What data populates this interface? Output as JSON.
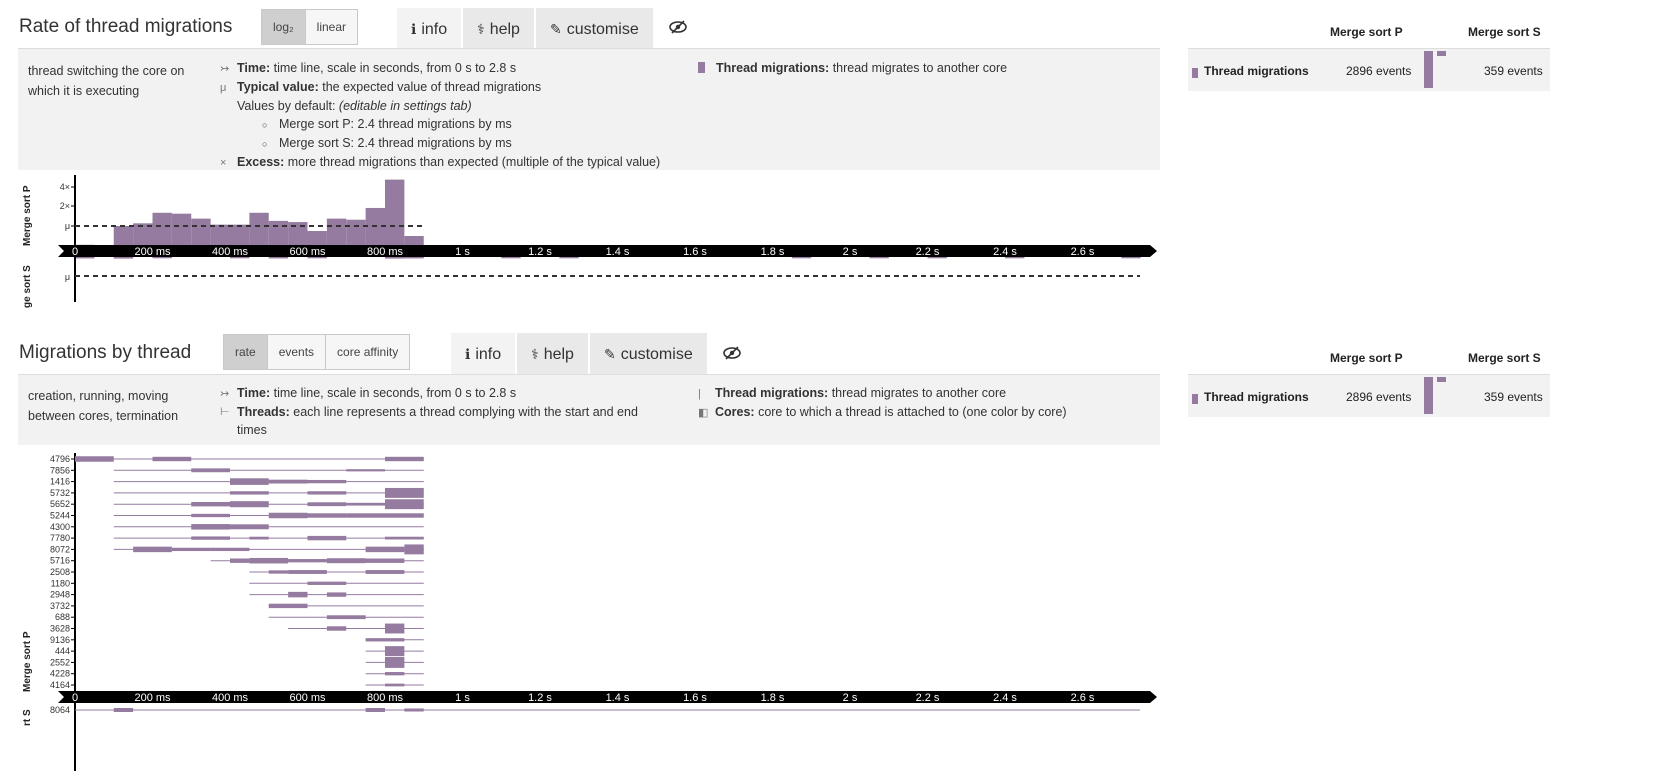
{
  "colors": {
    "accent": "#957ba0",
    "timeline": "#000000",
    "panel": "#f2f2f2"
  },
  "section1": {
    "title": "Rate of thread migrations",
    "scale_buttons": [
      {
        "label": "log₂",
        "active": true
      },
      {
        "label": "linear",
        "active": false
      }
    ],
    "tabs": [
      {
        "icon": "info-icon",
        "glyph": "ℹ",
        "label": "info"
      },
      {
        "icon": "stethoscope-icon",
        "glyph": "⚕",
        "label": "help"
      },
      {
        "icon": "brush-icon",
        "glyph": "🖌",
        "label": "customise"
      }
    ],
    "hide_icon": "eye-slash-icon",
    "description": "thread switching the core on which it is executing",
    "legend": {
      "time_bold": "Time:",
      "time_text": " time line, scale in seconds, from 0 s to 2.8 s",
      "typical_bold": "Typical value:",
      "typical_text": " the expected value of thread migrations",
      "defaults_text": "Values by default: ",
      "defaults_italic": "(editable in settings tab)",
      "default_items": [
        "Merge sort P: 2.4 thread migrations by ms",
        "Merge sort S: 2.4 thread migrations by ms"
      ],
      "excess_bold": "Excess:",
      "excess_text": " more thread migrations than expected (multiple of the typical value)",
      "metric_bold": "Thread migrations:",
      "metric_text": " thread migrates to another core"
    },
    "side": {
      "col1": "Merge sort P",
      "col2": "Merge sort S",
      "row_label": "Thread migrations",
      "val1": "2896 events",
      "val2": "359 events"
    },
    "chart": {
      "row1_label": "Merge sort P",
      "row2_label": "ge sort S",
      "yticks": [
        "4×",
        "2×",
        "μ"
      ],
      "row2_ytick": "μ",
      "axis_ticks": [
        "0",
        "200 ms",
        "400 ms",
        "600 ms",
        "800 ms",
        "1 s",
        "1.2 s",
        "1.4 s",
        "1.6 s",
        "1.8 s",
        "2 s",
        "2.2 s",
        "2.4 s",
        "2.6 s"
      ],
      "bar_width_ms": 50,
      "bars_p": [
        {
          "t": 0,
          "v": 0.25
        },
        {
          "t": 50,
          "v": 0.08
        },
        {
          "t": 100,
          "v": 1.0
        },
        {
          "t": 150,
          "v": 1.1
        },
        {
          "t": 200,
          "v": 1.6
        },
        {
          "t": 250,
          "v": 1.55
        },
        {
          "t": 300,
          "v": 1.3
        },
        {
          "t": 350,
          "v": 1.05
        },
        {
          "t": 400,
          "v": 1.05
        },
        {
          "t": 450,
          "v": 1.6
        },
        {
          "t": 500,
          "v": 1.2
        },
        {
          "t": 550,
          "v": 1.15
        },
        {
          "t": 600,
          "v": 0.8
        },
        {
          "t": 650,
          "v": 1.3
        },
        {
          "t": 700,
          "v": 1.25
        },
        {
          "t": 750,
          "v": 1.9
        },
        {
          "t": 800,
          "v": 5.2
        },
        {
          "t": 850,
          "v": 0.6
        }
      ],
      "bars_s": [
        {
          "t": 0,
          "v": 0.15
        },
        {
          "t": 100,
          "v": 0.2
        },
        {
          "t": 200,
          "v": 0.1
        },
        {
          "t": 400,
          "v": 0.1
        },
        {
          "t": 500,
          "v": 0.15
        },
        {
          "t": 600,
          "v": 0.1
        },
        {
          "t": 800,
          "v": 0.2
        },
        {
          "t": 850,
          "v": 0.15
        },
        {
          "t": 1100,
          "v": 0.1
        },
        {
          "t": 1250,
          "v": 0.1
        },
        {
          "t": 1850,
          "v": 0.1
        },
        {
          "t": 2050,
          "v": 0.1
        },
        {
          "t": 2200,
          "v": 0.1
        },
        {
          "t": 2400,
          "v": 0.1
        },
        {
          "t": 2700,
          "v": 0.1
        }
      ]
    }
  },
  "section2": {
    "title": "Migrations by thread",
    "mode_buttons": [
      {
        "label": "rate",
        "active": true
      },
      {
        "label": "events",
        "active": false
      },
      {
        "label": "core affinity",
        "active": false
      }
    ],
    "tabs": [
      {
        "icon": "info-icon",
        "glyph": "ℹ",
        "label": "info"
      },
      {
        "icon": "stethoscope-icon",
        "glyph": "⚕",
        "label": "help"
      },
      {
        "icon": "brush-icon",
        "glyph": "🖌",
        "label": "customise"
      }
    ],
    "hide_icon": "eye-slash-icon",
    "description": "creation, running, moving between cores, termination",
    "legend": {
      "time_bold": "Time:",
      "time_text": " time line, scale in seconds, from 0 s to 2.8 s",
      "threads_bold": "Threads:",
      "threads_text": " each line represents a thread complying with the start and end times",
      "metric_bold": "Thread migrations:",
      "metric_text": " thread migrates to another core",
      "cores_bold": "Cores:",
      "cores_text": " core to which a thread is attached to (one color by core)"
    },
    "side": {
      "col1": "Merge sort P",
      "col2": "Merge sort S",
      "row_label": "Thread migrations",
      "val1": "2896 events",
      "val2": "359 events"
    },
    "chart": {
      "row1_label": "Merge sort P",
      "row2_label": "rt S",
      "axis_ticks": [
        "0",
        "200 ms",
        "400 ms",
        "600 ms",
        "800 ms",
        "1 s",
        "1.2 s",
        "1.4 s",
        "1.6 s",
        "1.8 s",
        "2 s",
        "2.2 s",
        "2.4 s",
        "2.6 s"
      ],
      "threads_p": [
        {
          "id": "4796",
          "start": 0,
          "end": 900,
          "events": [
            [
              0,
              100,
              1.0
            ],
            [
              200,
              300,
              0.8
            ],
            [
              800,
              900,
              0.8
            ]
          ]
        },
        {
          "id": "7856",
          "start": 100,
          "end": 900,
          "events": [
            [
              300,
              400,
              0.7
            ],
            [
              700,
              800,
              0.4
            ]
          ]
        },
        {
          "id": "1416",
          "start": 100,
          "end": 900,
          "events": [
            [
              400,
              500,
              1.2
            ],
            [
              500,
              600,
              0.7
            ],
            [
              600,
              700,
              0.6
            ]
          ]
        },
        {
          "id": "5732",
          "start": 100,
          "end": 900,
          "events": [
            [
              400,
              500,
              0.6
            ],
            [
              600,
              700,
              0.6
            ],
            [
              800,
              900,
              1.8
            ]
          ]
        },
        {
          "id": "5652",
          "start": 100,
          "end": 900,
          "events": [
            [
              300,
              400,
              0.8
            ],
            [
              400,
              500,
              1.1
            ],
            [
              600,
              700,
              0.7
            ],
            [
              700,
              800,
              0.5
            ],
            [
              800,
              900,
              1.8
            ]
          ]
        },
        {
          "id": "5244",
          "start": 100,
          "end": 900,
          "events": [
            [
              300,
              400,
              0.6
            ],
            [
              500,
              600,
              1.0
            ],
            [
              600,
              700,
              0.8
            ],
            [
              700,
              800,
              0.8
            ],
            [
              800,
              900,
              0.8
            ]
          ]
        },
        {
          "id": "4300",
          "start": 100,
          "end": 900,
          "events": [
            [
              300,
              400,
              1.0
            ],
            [
              400,
              500,
              0.9
            ]
          ]
        },
        {
          "id": "7780",
          "start": 100,
          "end": 900,
          "events": [
            [
              300,
              400,
              0.6
            ],
            [
              450,
              500,
              0.5
            ],
            [
              600,
              700,
              0.8
            ],
            [
              800,
              900,
              0.5
            ]
          ]
        },
        {
          "id": "8072",
          "start": 100,
          "end": 900,
          "events": [
            [
              150,
              250,
              1.0
            ],
            [
              250,
              350,
              0.6
            ],
            [
              350,
              450,
              0.6
            ],
            [
              750,
              850,
              1.0
            ],
            [
              850,
              900,
              1.8
            ]
          ]
        },
        {
          "id": "5716",
          "start": 350,
          "end": 900,
          "events": [
            [
              400,
              450,
              0.8
            ],
            [
              450,
              550,
              1.0
            ],
            [
              550,
              650,
              0.6
            ],
            [
              650,
              750,
              0.9
            ],
            [
              750,
              850,
              0.8
            ]
          ]
        },
        {
          "id": "2508",
          "start": 450,
          "end": 900,
          "events": [
            [
              500,
              550,
              0.6
            ],
            [
              550,
              650,
              0.7
            ],
            [
              750,
              850,
              0.7
            ]
          ]
        },
        {
          "id": "1180",
          "start": 450,
          "end": 900,
          "events": [
            [
              600,
              700,
              0.6
            ]
          ]
        },
        {
          "id": "2948",
          "start": 450,
          "end": 900,
          "events": [
            [
              550,
              600,
              1.0
            ],
            [
              650,
              700,
              0.8
            ]
          ]
        },
        {
          "id": "3732",
          "start": 500,
          "end": 900,
          "events": [
            [
              500,
              600,
              0.8
            ]
          ]
        },
        {
          "id": "688",
          "start": 500,
          "end": 900,
          "events": [
            [
              650,
              750,
              0.7
            ]
          ]
        },
        {
          "id": "3628",
          "start": 550,
          "end": 900,
          "events": [
            [
              650,
              700,
              0.8
            ],
            [
              800,
              850,
              1.8
            ]
          ]
        },
        {
          "id": "9136",
          "start": 750,
          "end": 900,
          "events": [
            [
              750,
              850,
              0.6
            ]
          ]
        },
        {
          "id": "444",
          "start": 750,
          "end": 900,
          "events": [
            [
              800,
              850,
              1.8
            ]
          ]
        },
        {
          "id": "2552",
          "start": 750,
          "end": 900,
          "events": [
            [
              800,
              850,
              2.0
            ]
          ]
        },
        {
          "id": "4228",
          "start": 750,
          "end": 900,
          "events": [
            [
              800,
              850,
              0.6
            ]
          ]
        },
        {
          "id": "4164",
          "start": 750,
          "end": 900,
          "events": [
            [
              800,
              850,
              0.5
            ]
          ]
        }
      ],
      "threads_s": [
        {
          "id": "8064",
          "start": 0,
          "end": 2800,
          "events": [
            [
              100,
              150,
              0.8
            ],
            [
              750,
              800,
              0.8
            ],
            [
              850,
              900,
              0.6
            ]
          ]
        }
      ]
    }
  }
}
